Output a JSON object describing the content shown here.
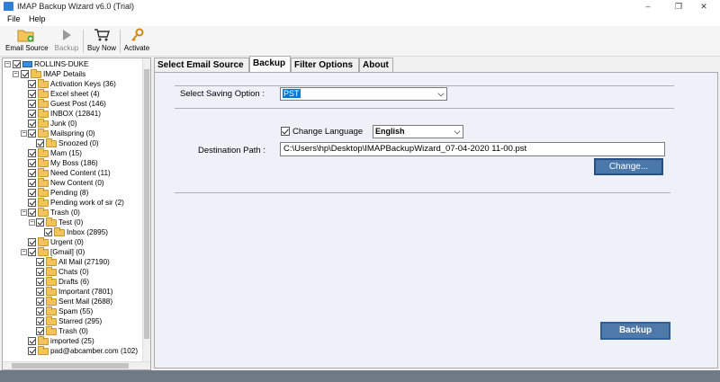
{
  "window": {
    "title": "IMAP Backup Wizard v6.0 (Trial)",
    "minimize": "–",
    "maximize": "❐",
    "close": "✕"
  },
  "menu": {
    "file": "File",
    "help": "Help"
  },
  "toolbar": {
    "email_source": "Email Source",
    "backup": "Backup",
    "buy_now": "Buy Now",
    "activate": "Activate"
  },
  "tree": {
    "items": [
      {
        "label": "ROLLINS-DUKE"
      },
      {
        "label": "IMAP Details"
      },
      {
        "label": "Activation Keys (36)"
      },
      {
        "label": "Excel sheet (4)"
      },
      {
        "label": "Guest Post (146)"
      },
      {
        "label": "INBOX (12841)"
      },
      {
        "label": "Junk (0)"
      },
      {
        "label": "Mailspring (0)"
      },
      {
        "label": "Snoozed (0)"
      },
      {
        "label": "Mam (15)"
      },
      {
        "label": "My Boss (186)"
      },
      {
        "label": "Need Content (11)"
      },
      {
        "label": "New Content (0)"
      },
      {
        "label": "Pending (8)"
      },
      {
        "label": "Pending work of sir (2)"
      },
      {
        "label": "Trash (0)"
      },
      {
        "label": "Test (0)"
      },
      {
        "label": "Inbox (2895)"
      },
      {
        "label": "Urgent (0)"
      },
      {
        "label": "[Gmail] (0)"
      },
      {
        "label": "All Mail (27190)"
      },
      {
        "label": "Chats (0)"
      },
      {
        "label": "Drafts (6)"
      },
      {
        "label": "Important (7801)"
      },
      {
        "label": "Sent Mail (2688)"
      },
      {
        "label": "Spam (55)"
      },
      {
        "label": "Starred (295)"
      },
      {
        "label": "Trash (0)"
      },
      {
        "label": "imported (25)"
      },
      {
        "label": "pad@abcamber.com (102)"
      }
    ]
  },
  "tabs": {
    "select_source": "Select Email Source",
    "backup": "Backup",
    "filter_options": "Filter Options",
    "about": "About"
  },
  "backup": {
    "saving_option_label": "Select Saving Option :",
    "saving_option_value": "PST",
    "change_language_label": "Change Language",
    "language_value": "English",
    "destination_label": "Destination Path :",
    "destination_value": "C:\\Users\\hp\\Desktop\\IMAPBackupWizard_07-04-2020 11-00.pst",
    "change_button": "Change...",
    "backup_button": "Backup"
  },
  "colors": {
    "accent_button": "#4f79a8",
    "status_bar": "#707a86",
    "selection": "#0078d7"
  }
}
